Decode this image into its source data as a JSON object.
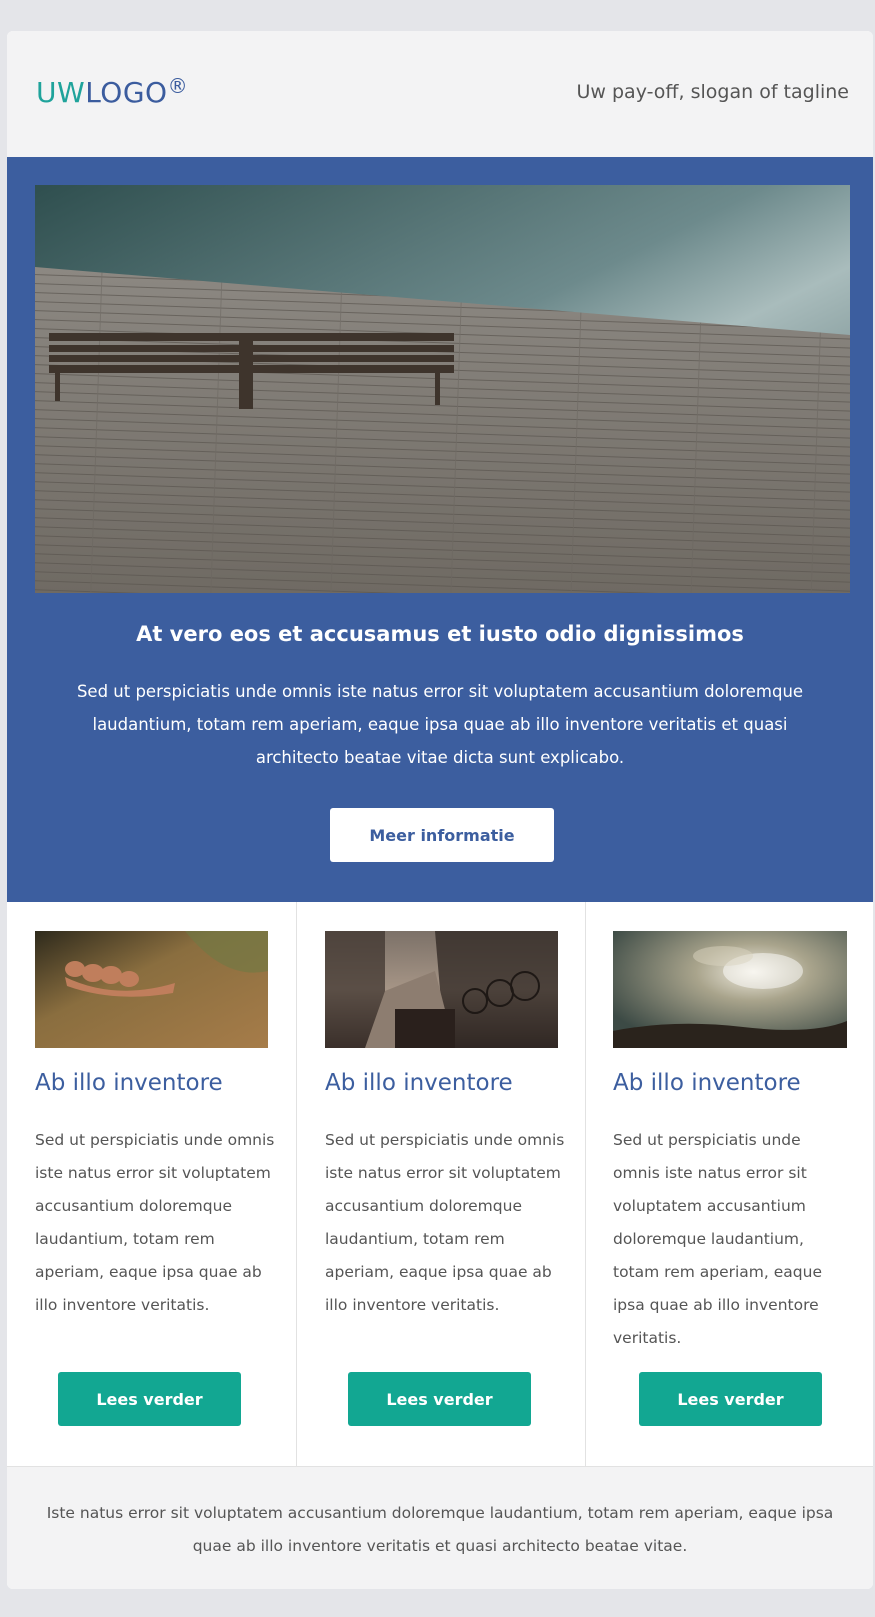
{
  "header": {
    "logo_prefix": "UW",
    "logo_main": "LOGO",
    "logo_mark": "®",
    "tagline": "Uw pay-off, slogan of tagline"
  },
  "hero": {
    "title": "At vero eos et accusamus et iusto odio dignissimos",
    "text": "Sed ut perspiciatis unde omnis iste natus error sit voluptatem accusantium doloremque laudantium, totam rem aperiam, eaque ipsa quae ab illo inventore veritatis et quasi architecto beatae vitae dicta sunt explicabo.",
    "button_label": "Meer informatie"
  },
  "columns": [
    {
      "title": "Ab illo inventore",
      "text": "Sed ut perspiciatis unde omnis iste natus error sit voluptatem accusantium doloremque laudantium, totam rem aperiam, eaque ipsa quae ab illo inventore veritatis.",
      "button_label": "Lees verder"
    },
    {
      "title": "Ab illo inventore",
      "text": "Sed ut perspiciatis unde omnis iste natus error sit voluptatem accusantium doloremque laudantium, totam rem aperiam, eaque ipsa quae ab illo inventore veritatis.",
      "button_label": "Lees verder"
    },
    {
      "title": "Ab illo inventore",
      "text": "Sed ut perspiciatis unde omnis iste natus error sit voluptatem accusantium doloremque laudantium, totam rem aperiam, eaque ipsa quae ab illo inventore veritatis.",
      "button_label": "Lees verder"
    }
  ],
  "footer": {
    "text": "Iste natus error sit voluptatem accusantium doloremque laudantium, totam rem aperiam, eaque ipsa quae ab illo inventore veritatis et quasi architecto beatae vitae."
  },
  "colors": {
    "brand_blue": "#3c5e9f",
    "brand_teal": "#1fa39b",
    "button_green": "#12a792"
  }
}
